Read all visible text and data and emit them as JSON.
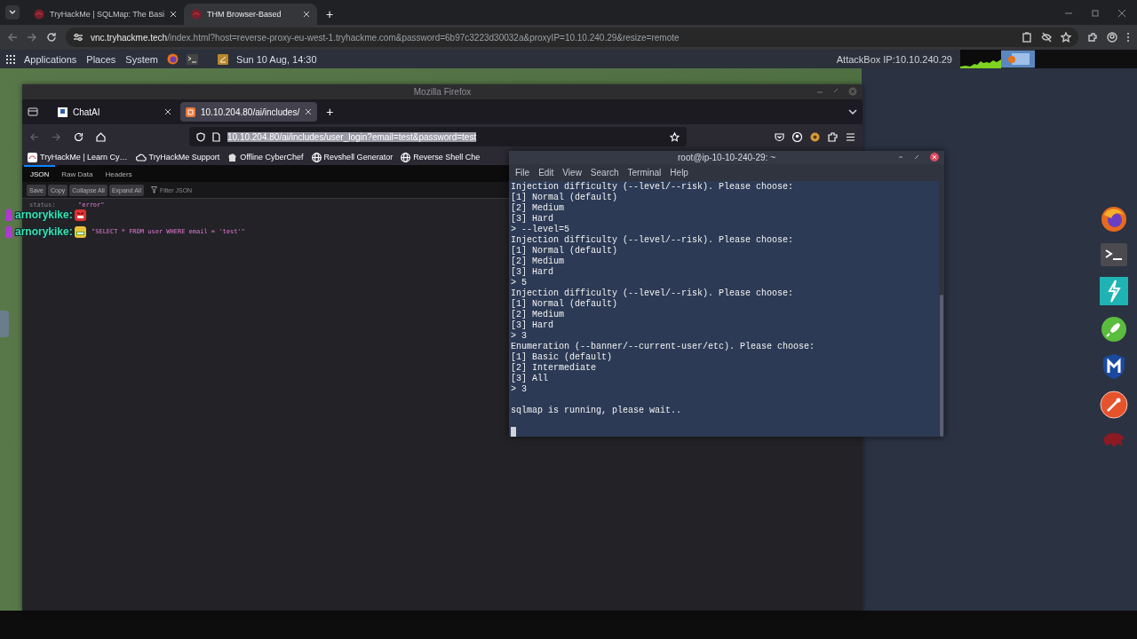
{
  "browser": {
    "tabs": [
      {
        "title": "TryHackMe | SQLMap: The Basi",
        "selected": false
      },
      {
        "title": "THM Browser-Based",
        "selected": true
      }
    ],
    "new_tab": "+",
    "address": {
      "host": "vnc.tryhackme.tech",
      "path": "/index.html?host=reverse-proxy-eu-west-1.tryhackme.com&password=6b97c3223d30032a&proxyIP=10.10.240.29&resize=remote"
    }
  },
  "panel": {
    "menus": [
      "Applications",
      "Places",
      "System"
    ],
    "clock": "Sun 10 Aug, 14:30",
    "ip_label": "AttackBox IP:10.10.240.29"
  },
  "firefox": {
    "title": "Mozilla Firefox",
    "tabs": [
      {
        "title": "ChatAI",
        "selected": false,
        "kind": "page"
      },
      {
        "title": "10.10.204.80/ai/includes/",
        "selected": true,
        "kind": "json"
      }
    ],
    "new_tab": "+",
    "url": {
      "text": "10.10.204.80/ai/includes/user_login?email=test&password=test",
      "selected": true
    },
    "bookmarks": [
      {
        "label": "TryHackMe | Learn Cy…",
        "kind": "site"
      },
      {
        "label": "TryHackMe Support",
        "kind": "cloud"
      },
      {
        "label": "Offline CyberChef",
        "kind": "chef"
      },
      {
        "label": "Revshell Generator",
        "kind": "globe"
      },
      {
        "label": "Reverse Shell Che",
        "kind": "globe"
      }
    ],
    "viewer": {
      "tabs": [
        {
          "label": "JSON",
          "selected": true
        },
        {
          "label": "Raw Data",
          "selected": false
        },
        {
          "label": "Headers",
          "selected": false
        }
      ],
      "buttons": [
        "Save",
        "Copy",
        "Collapse All",
        "Expand All"
      ],
      "filter": {
        "placeholder": "Filter JSON"
      },
      "rows": [
        {
          "key": "status:",
          "value": "\"error\""
        },
        {
          "value": "\"SELECT * FROM user WHERE email = 'test'\""
        }
      ]
    }
  },
  "terminal": {
    "title": "root@ip-10-10-240-29: ~",
    "menu": [
      "File",
      "Edit",
      "View",
      "Search",
      "Terminal",
      "Help"
    ],
    "lines": [
      "Injection difficulty (--level/--risk). Please choose:",
      "[1] Normal (default)",
      "[2] Medium",
      "[3] Hard",
      "> --level=5",
      "Injection difficulty (--level/--risk). Please choose:",
      "[1] Normal (default)",
      "[2] Medium",
      "[3] Hard",
      "> 5",
      "Injection difficulty (--level/--risk). Please choose:",
      "[1] Normal (default)",
      "[2] Medium",
      "[3] Hard",
      "> 3",
      "Enumeration (--banner/--current-user/etc). Please choose:",
      "[1] Basic (default)",
      "[2] Intermediate",
      "[3] All",
      "> 3"
    ],
    "status_line": "sqlmap is running, please wait.."
  },
  "chat": [
    {
      "user": "arnorykike:",
      "kind": "angry"
    },
    {
      "user": "arnorykike:",
      "kind": "grin"
    }
  ]
}
